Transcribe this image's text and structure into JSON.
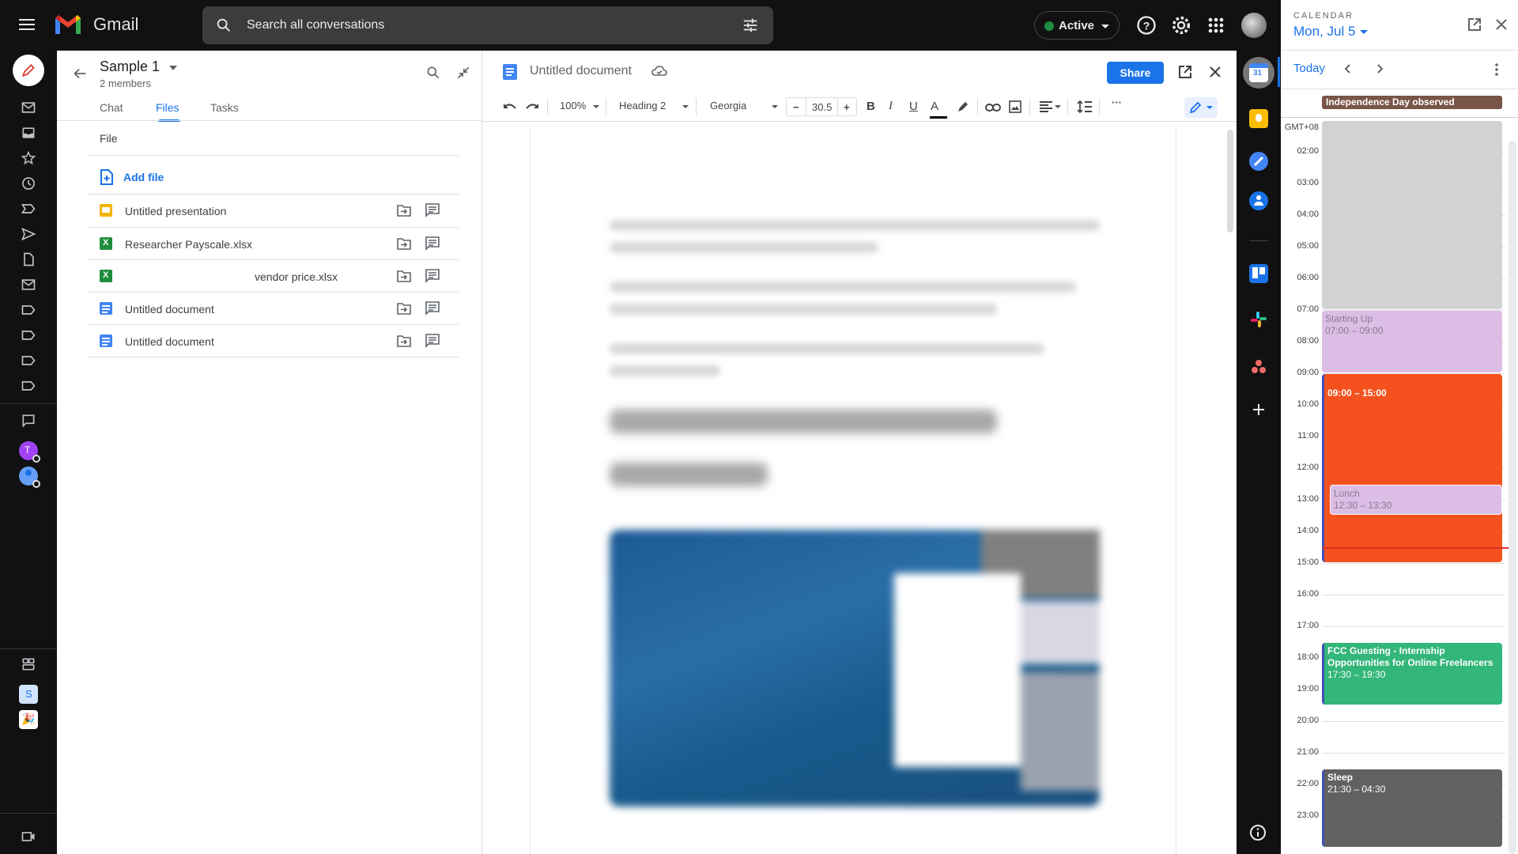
{
  "topbar": {
    "app_name": "Gmail",
    "search_placeholder": "Search all conversations",
    "status": "Active",
    "status_color": "#1e8e3e"
  },
  "rail": {
    "icons": [
      "compose-icon",
      "mail-icon",
      "inbox-icon",
      "star-icon",
      "snooze-icon",
      "important-icon",
      "send-icon",
      "draft-icon",
      "all-mail-icon",
      "label-icon",
      "label-icon",
      "label-icon",
      "label-icon",
      "chat-icon"
    ],
    "avatars": [
      {
        "initial": "T",
        "color": "#a142f4"
      },
      {
        "initial": "",
        "color": "#4285f4"
      }
    ],
    "spaces": [
      {
        "label": "S",
        "color": "#d2e3fc"
      },
      {
        "label": "🎉",
        "color": "#fff"
      }
    ]
  },
  "chat_panel": {
    "title": "Sample 1",
    "subtitle": "2 members",
    "tabs": [
      {
        "label": "Chat"
      },
      {
        "label": "Files",
        "active": true
      },
      {
        "label": "Tasks"
      }
    ],
    "file_header": "File",
    "add_file": "Add file",
    "files": [
      {
        "name": "Untitled presentation",
        "type": "slides",
        "color": "#f4b400"
      },
      {
        "name": "Researcher Payscale.xlsx",
        "type": "excel",
        "color": "#1e8e3e"
      },
      {
        "name": "vendor price.xlsx",
        "type": "excel",
        "color": "#1e8e3e"
      },
      {
        "name": "Untitled document",
        "type": "docs",
        "color": "#4285f4"
      },
      {
        "name": "Untitled document",
        "type": "docs",
        "color": "#4285f4"
      }
    ]
  },
  "doc": {
    "title": "Untitled document",
    "share_label": "Share",
    "toolbar": {
      "zoom": "100%",
      "style": "Heading 2",
      "font": "Georgia",
      "font_size": "30.5",
      "text_color": "#000000"
    },
    "content_blurred": true
  },
  "calendar": {
    "label": "CALENDAR",
    "date": "Mon, Jul 5",
    "today_label": "Today",
    "all_day_event": {
      "title": "Independence Day observed",
      "color": "#795548"
    },
    "timezone": "GMT+08",
    "hours": [
      "02:00",
      "03:00",
      "04:00",
      "05:00",
      "06:00",
      "07:00",
      "08:00",
      "09:00",
      "10:00",
      "11:00",
      "12:00",
      "13:00",
      "14:00",
      "15:00",
      "16:00",
      "17:00",
      "18:00",
      "19:00",
      "20:00",
      "21:00",
      "22:00",
      "23:00"
    ],
    "now": "14:30",
    "events": [
      {
        "title": "",
        "time": "",
        "start": 1,
        "end": 7,
        "color": "#d2d2d2",
        "text_color": "#3c4043"
      },
      {
        "title": "Starting Up",
        "time": "07:00 – 09:00",
        "start": 7,
        "end": 9,
        "color": "#dcbde6",
        "text_color": "#8a7a92"
      },
      {
        "title": "",
        "time": "09:00 – 15:00",
        "start": 9,
        "end": 15,
        "color": "#f4511e",
        "text_color": "#ffffff"
      },
      {
        "title": "Lunch",
        "time": "12:30 – 13:30",
        "start": 12.5,
        "end": 13.5,
        "color": "#dcbde6",
        "text_color": "#8a7a92",
        "offset": true
      },
      {
        "title": "FCC Guesting - Internship Opportunities for Online Freelancers",
        "time": "17:30 – 19:30",
        "start": 17.5,
        "end": 19.5,
        "color": "#33b679",
        "text_color": "#ffffff"
      },
      {
        "title": "Sleep",
        "time": "21:30 – 04:30",
        "start": 21.5,
        "end": 24,
        "color": "#616161",
        "text_color": "#ffffff"
      }
    ]
  }
}
